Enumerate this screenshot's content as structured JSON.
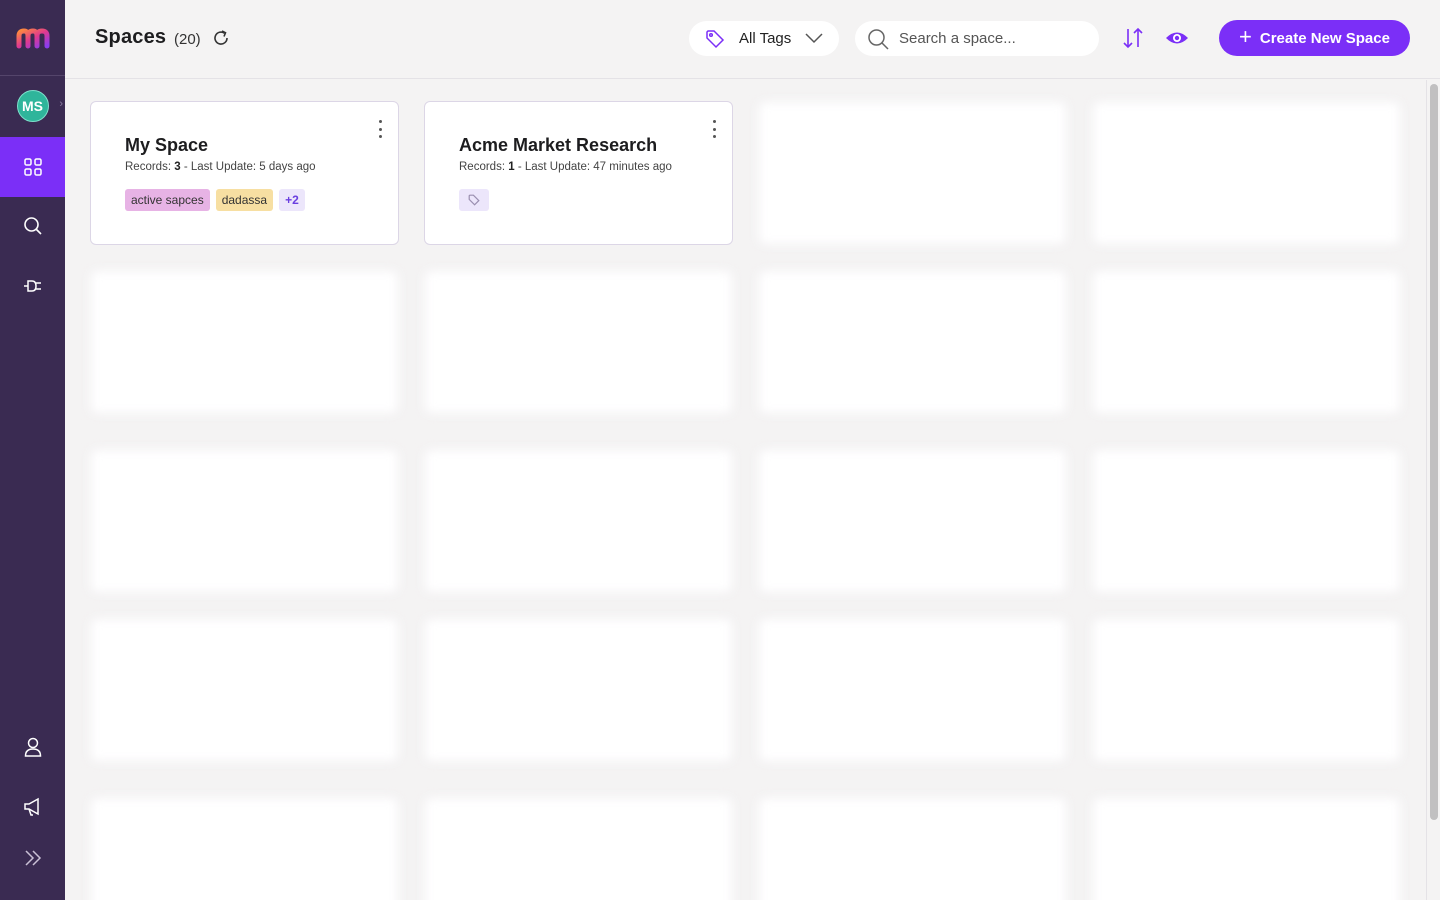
{
  "header": {
    "title": "Spaces",
    "count": "(20)",
    "tags_filter": "All Tags",
    "search_placeholder": "Search a space...",
    "create_label": "Create New Space"
  },
  "sidebar": {
    "avatar_initials": "MS"
  },
  "colors": {
    "sidebar": "#3a2b52",
    "accent": "#7b2ff7",
    "avatar": "#2fb59b"
  },
  "cards": [
    {
      "name": "My Space",
      "records_label": "Records:",
      "records": "3",
      "updated": " - Last Update: 5 days ago",
      "tags": [
        "active sapces",
        "dadassa"
      ],
      "more": "+2"
    },
    {
      "name": "Acme Market Research",
      "records_label": "Records:",
      "records": "1",
      "updated": " - Last Update: 47 minutes ago"
    }
  ]
}
